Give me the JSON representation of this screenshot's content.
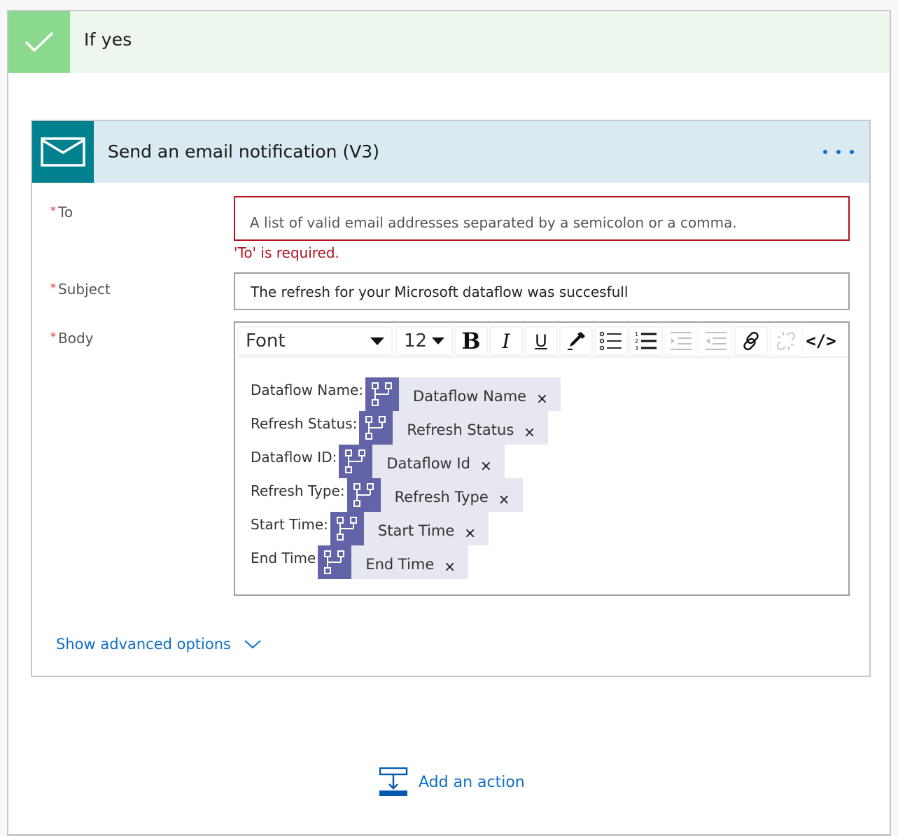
{
  "condition": {
    "title": "If yes",
    "icon": "checkmark-icon",
    "accent_color": "#8bd98f",
    "header_bg": "#edf7ee"
  },
  "action_card": {
    "title": "Send an email notification (V3)",
    "icon": "mail-icon",
    "icon_bg": "#00818f",
    "header_bg": "#d9ebf0",
    "menu_icon": "more-options-icon",
    "fields": {
      "to": {
        "label": "To",
        "required_marker": "*",
        "value": "",
        "placeholder": "A list of valid email addresses separated by a semicolon or a comma.",
        "error": "'To' is required.",
        "error_color": "#b4101f"
      },
      "subject": {
        "label": "Subject",
        "required_marker": "*",
        "value": "The refresh for your Microsoft dataflow  was succesfull"
      },
      "body": {
        "label": "Body",
        "required_marker": "*",
        "toolbar": {
          "font_select": "Font",
          "size_select": "12",
          "buttons": [
            {
              "name": "bold",
              "glyph": "B",
              "icon": "bold-icon"
            },
            {
              "name": "italic",
              "glyph": "I",
              "icon": "italic-icon"
            },
            {
              "name": "underline",
              "glyph": "U",
              "icon": "underline-icon"
            },
            {
              "name": "text-color",
              "icon": "color-picker-icon"
            },
            {
              "name": "bulleted-list",
              "icon": "bulleted-list-icon"
            },
            {
              "name": "numbered-list",
              "icon": "numbered-list-icon"
            },
            {
              "name": "increase-indent",
              "icon": "indent-icon",
              "disabled": true
            },
            {
              "name": "decrease-indent",
              "icon": "outdent-icon",
              "disabled": true
            },
            {
              "name": "insert-link",
              "icon": "link-icon"
            },
            {
              "name": "remove-link",
              "icon": "unlink-icon",
              "disabled": true
            },
            {
              "name": "code-view",
              "glyph": "</>",
              "icon": "code-icon"
            }
          ]
        },
        "lines": [
          {
            "label": "Dataflow Name:",
            "token": "Dataflow Name"
          },
          {
            "label": "Refresh Status:",
            "token": "Refresh Status"
          },
          {
            "label": "Dataflow ID:",
            "token": "Dataflow Id"
          },
          {
            "label": "Refresh Type:",
            "token": "Refresh Type"
          },
          {
            "label": "Start Time:",
            "token": "Start Time"
          },
          {
            "label": "End Time",
            "token": "End Time"
          }
        ],
        "token_icon": "dataflow-icon",
        "token_icon_bg": "#6264a7",
        "token_bg": "#e7e7f2",
        "token_remove_glyph": "×"
      }
    },
    "advanced_options_label": "Show advanced options"
  },
  "add_action": {
    "label": "Add an action",
    "icon": "add-action-icon",
    "link_color": "#0f6fc6"
  }
}
